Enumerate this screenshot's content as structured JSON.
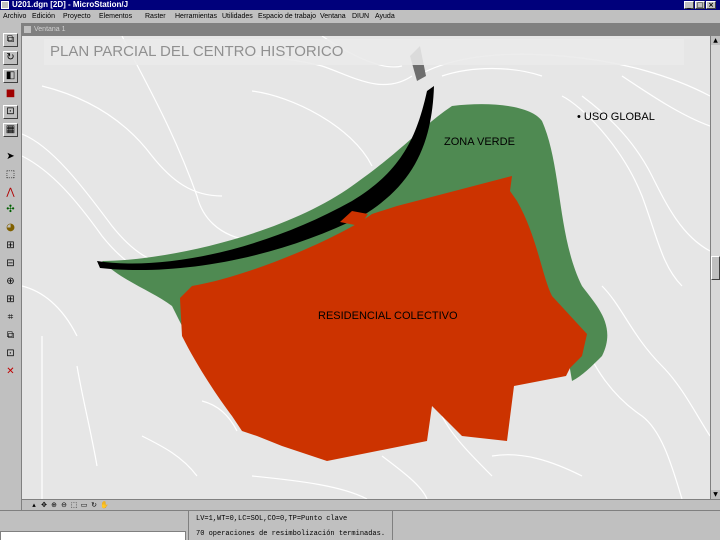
{
  "window": {
    "title": "U201.dgn [2D] - MicroStation/J"
  },
  "menu": [
    "Archivo",
    "Edición",
    "Proyecto",
    "Elementos",
    "Raster",
    "Herramientas",
    "Utilidades",
    "Espacio de trabajo",
    "Ventana",
    "DIUN",
    "Ayuda"
  ],
  "view": {
    "name": "Ventana 1"
  },
  "map": {
    "title": "PLAN PARCIAL DEL CENTRO HISTORICO",
    "legend": "• USO GLOBAL",
    "zones": {
      "green": "ZONA VERDE",
      "residential": "RESIDENCIAL COLECTIVO"
    },
    "colors": {
      "background": "#e6e6e6",
      "green": "#4f8a52",
      "residential": "#cc3300",
      "road": "#000000",
      "street_lines": "#ffffff"
    }
  },
  "status": {
    "line1": "LV=1,WT=0,LC=SOL,CO=0,TP=Punto clave",
    "line2": "70 operaciones de resimbolización terminadas."
  },
  "icons": {
    "palette": [
      "copy-icon",
      "rotate-icon",
      "mirror-icon",
      "element-info-icon",
      "scale-icon",
      "array-icon",
      "select-arrow-icon",
      "fence-icon",
      "line-icon",
      "point-icon",
      "fill-icon",
      "measure-icon",
      "pan-icon",
      "zoom-icon",
      "grid-icon",
      "snap-icon",
      "copy-parallel-icon",
      "reference-icon",
      "delete-icon"
    ]
  }
}
